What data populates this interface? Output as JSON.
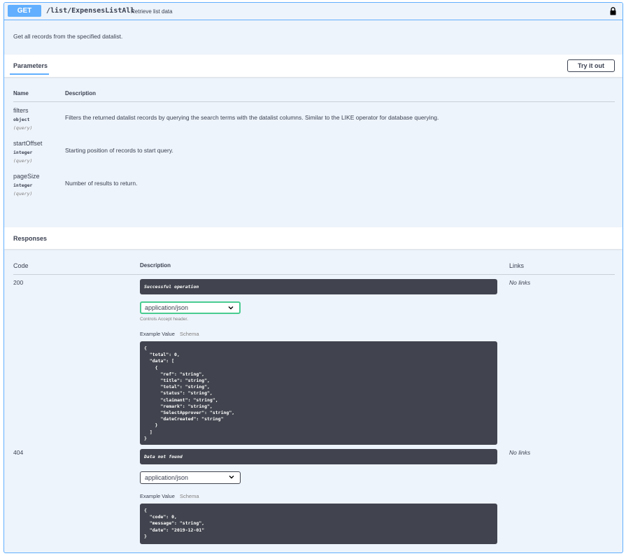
{
  "summary": {
    "method": "GET",
    "path": "/list/ExpensesListAll",
    "description": "Retrieve list data"
  },
  "description": "Get all records from the specified datalist.",
  "parameters": {
    "title": "Parameters",
    "try_label": "Try it out",
    "headers": {
      "name": "Name",
      "description": "Description"
    },
    "items": [
      {
        "name": "filters",
        "type": "object",
        "in": "(query)",
        "description": "Filters the returned datalist records by querying the search terms with the datalist columns. Similar to the LIKE operator for database querying."
      },
      {
        "name": "startOffset",
        "type": "integer",
        "in": "(query)",
        "description": "Starting position of records to start query."
      },
      {
        "name": "pageSize",
        "type": "integer",
        "in": "(query)",
        "description": "Number of results to return."
      }
    ]
  },
  "responses": {
    "title": "Responses",
    "headers": {
      "code": "Code",
      "description": "Description",
      "links": "Links"
    },
    "items": [
      {
        "code": "200",
        "message": "Successful operation",
        "media_type": "application/json",
        "controls_note": "Controls Accept header.",
        "example_tab": "Example Value",
        "schema_tab": "Schema",
        "example": "{\n  \"total\": 0,\n  \"data\": [\n    {\n      \"ref\": \"string\",\n      \"title\": \"string\",\n      \"total\": \"string\",\n      \"status\": \"string\",\n      \"claimant\": \"string\",\n      \"remark\": \"string\",\n      \"SelectApprover\": \"string\",\n      \"dateCreated\": \"string\"\n    }\n  ]\n}",
        "links": "No links"
      },
      {
        "code": "404",
        "message": "Data not found",
        "media_type": "application/json",
        "example_tab": "Example Value",
        "schema_tab": "Schema",
        "example": "{\n  \"code\": 0,\n  \"message\": \"string\",\n  \"date\": \"2019-12-01\"\n}",
        "links": "No links"
      }
    ]
  },
  "colors": {
    "accent": "#61affe",
    "dark": "#41444e",
    "success": "#49cc90"
  }
}
